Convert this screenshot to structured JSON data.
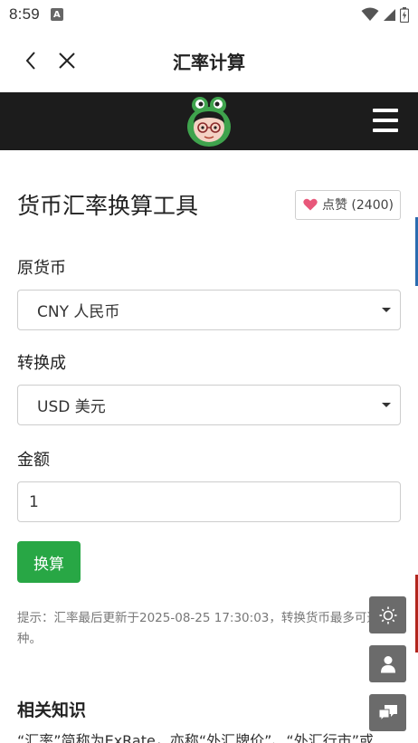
{
  "status_bar": {
    "time": "8:59",
    "notification_icon": "A"
  },
  "header": {
    "title": "汇率计算"
  },
  "page": {
    "title": "货币汇率换算工具",
    "like_label": "点赞 (2400)"
  },
  "form": {
    "from_label": "原货币",
    "from_value": "CNY 人民币",
    "to_label": "转换成",
    "to_value": "USD 美元",
    "amount_label": "金额",
    "amount_value": "1",
    "convert_label": "换算"
  },
  "hint": "提示：汇率最后更新于2025-08-25 17:30:03，转换货币最多可选10种。",
  "knowledge": {
    "title": "相关知识",
    "text": "“汇率”简称为ExRate，亦称“外汇牌价”、“外汇行市”或"
  },
  "colors": {
    "nav_bg": "#1c1c1c",
    "primary_green": "#28a745",
    "float_btn": "#6b6b6b",
    "heart": "#e8577a"
  }
}
